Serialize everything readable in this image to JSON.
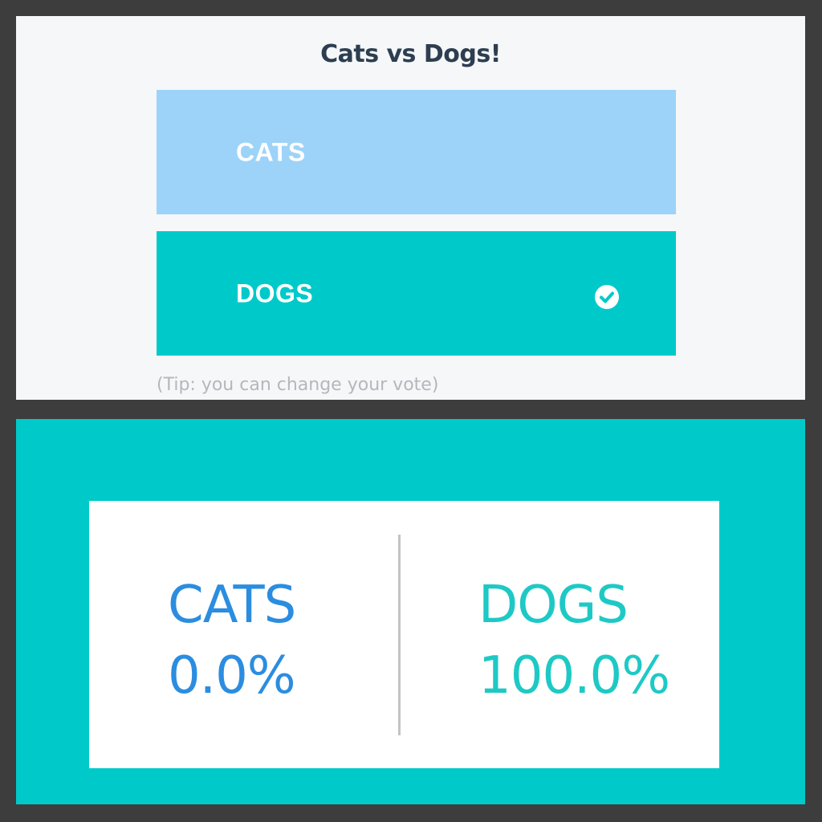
{
  "poll": {
    "title": "Cats vs Dogs!",
    "options": [
      {
        "label": "CATS",
        "selected": false,
        "color": "#9dd3f8"
      },
      {
        "label": "DOGS",
        "selected": true,
        "color": "#00cac9"
      }
    ],
    "selected_icon": "check-circle-icon",
    "tip": "(Tip: you can change your vote)"
  },
  "results": {
    "background_color": "#00cac9",
    "items": [
      {
        "name": "CATS",
        "percent": "0.0%",
        "color": "#2b8de0"
      },
      {
        "name": "DOGS",
        "percent": "100.0%",
        "color": "#1ec9c5"
      }
    ]
  }
}
